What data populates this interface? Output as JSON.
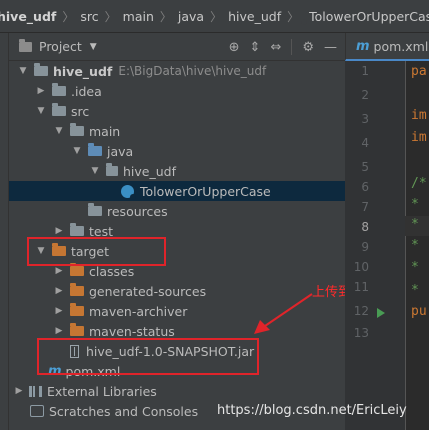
{
  "breadcrumb": [
    "hive_udf",
    "src",
    "main",
    "java",
    "hive_udf",
    "TolowerOrUpperCase"
  ],
  "project_panel": {
    "title": "Project",
    "header_icons": [
      "target-icon",
      "expand-icon",
      "collapse-icon",
      "gear-icon",
      "minimize-icon"
    ]
  },
  "tree": [
    {
      "label": "hive_udf",
      "path": "E:\\BigData\\hive\\hive_udf",
      "expanded": true,
      "icon": "module-folder-icon"
    },
    {
      "label": ".idea",
      "expanded": false,
      "icon": "folder-icon"
    },
    {
      "label": "src",
      "expanded": true,
      "icon": "folder-icon"
    },
    {
      "label": "main",
      "expanded": true,
      "icon": "folder-icon"
    },
    {
      "label": "java",
      "expanded": true,
      "icon": "source-folder-icon"
    },
    {
      "label": "hive_udf",
      "expanded": true,
      "icon": "package-icon"
    },
    {
      "label": "TolowerOrUpperCase",
      "selected": true,
      "icon": "class-icon"
    },
    {
      "label": "resources",
      "icon": "resources-folder-icon"
    },
    {
      "label": "test",
      "expanded": false,
      "icon": "folder-icon"
    },
    {
      "label": "target",
      "expanded": true,
      "icon": "excluded-folder-icon"
    },
    {
      "label": "classes",
      "expanded": false,
      "icon": "excluded-folder-icon"
    },
    {
      "label": "generated-sources",
      "expanded": false,
      "icon": "excluded-folder-icon"
    },
    {
      "label": "maven-archiver",
      "expanded": false,
      "icon": "excluded-folder-icon"
    },
    {
      "label": "maven-status",
      "expanded": false,
      "icon": "excluded-folder-icon"
    },
    {
      "label": "hive_udf-1.0-SNAPSHOT.jar",
      "icon": "jar-icon"
    },
    {
      "label": "pom.xml",
      "icon": "maven-icon"
    },
    {
      "label": "External Libraries",
      "expanded": false,
      "icon": "library-icon"
    },
    {
      "label": "Scratches and Consoles",
      "icon": "scratches-icon"
    }
  ],
  "annotation": {
    "text": "上传到hive",
    "color": "#e0242a"
  },
  "watermark": "https://blog.csdn.net/EricLeiy",
  "editor": {
    "tab_label": "pom.xml",
    "line_numbers": [
      "1",
      "2",
      "3",
      "4",
      "5",
      "6",
      "7",
      "8",
      "9",
      "10",
      "11",
      "12",
      "13"
    ],
    "code_fragments": [
      "pa",
      "",
      "im",
      "im",
      "",
      "/*",
      "*",
      "*",
      "*",
      "*",
      "*",
      "pu",
      ""
    ]
  },
  "colors": {
    "panel_bg": "#3c3f41",
    "editor_bg": "#2b2b2b",
    "selection": "#0d293e",
    "excluded_folder": "#c57633",
    "annotation_red": "#e0242a"
  }
}
